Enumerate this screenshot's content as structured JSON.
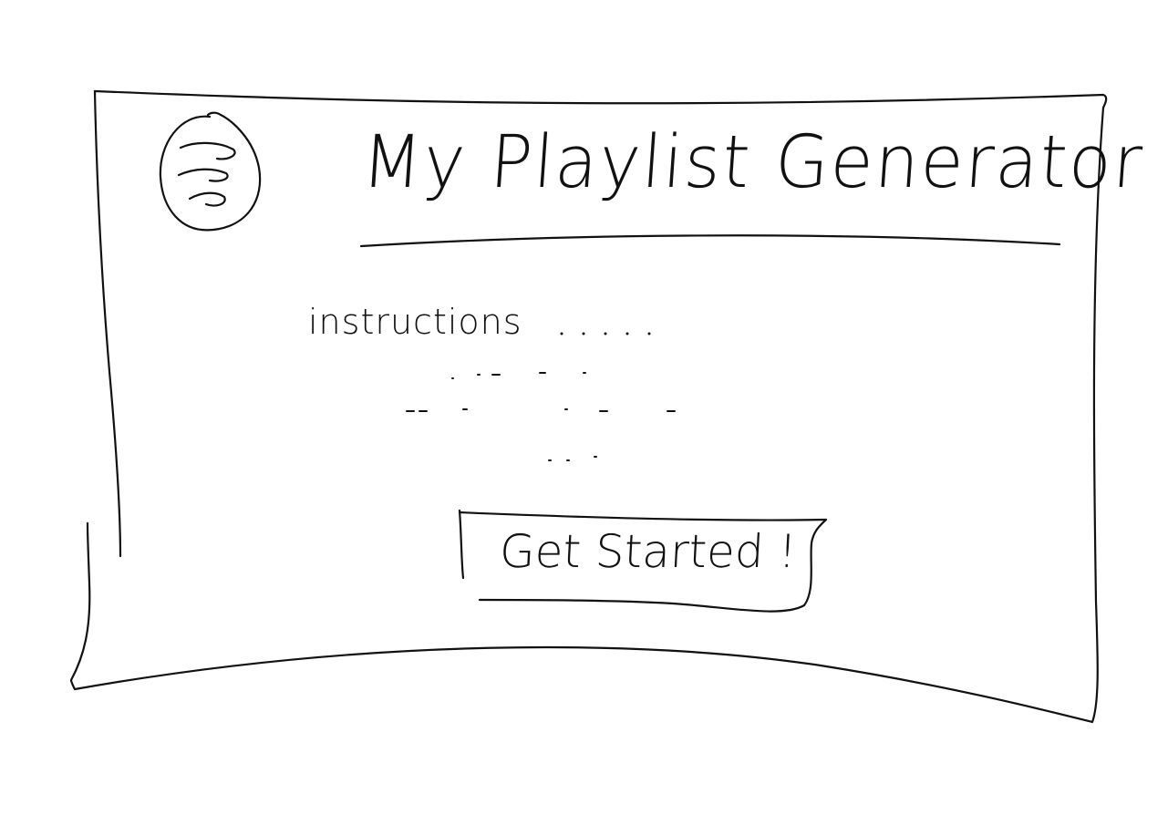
{
  "page": {
    "title": "My Playlist Generator",
    "instructions_label": "instructions",
    "start_button_label": "Get Started !"
  },
  "logo": {
    "icon": "spotify-like-logo-icon"
  },
  "colors": {
    "ink": "#111111",
    "background": "#ffffff"
  }
}
